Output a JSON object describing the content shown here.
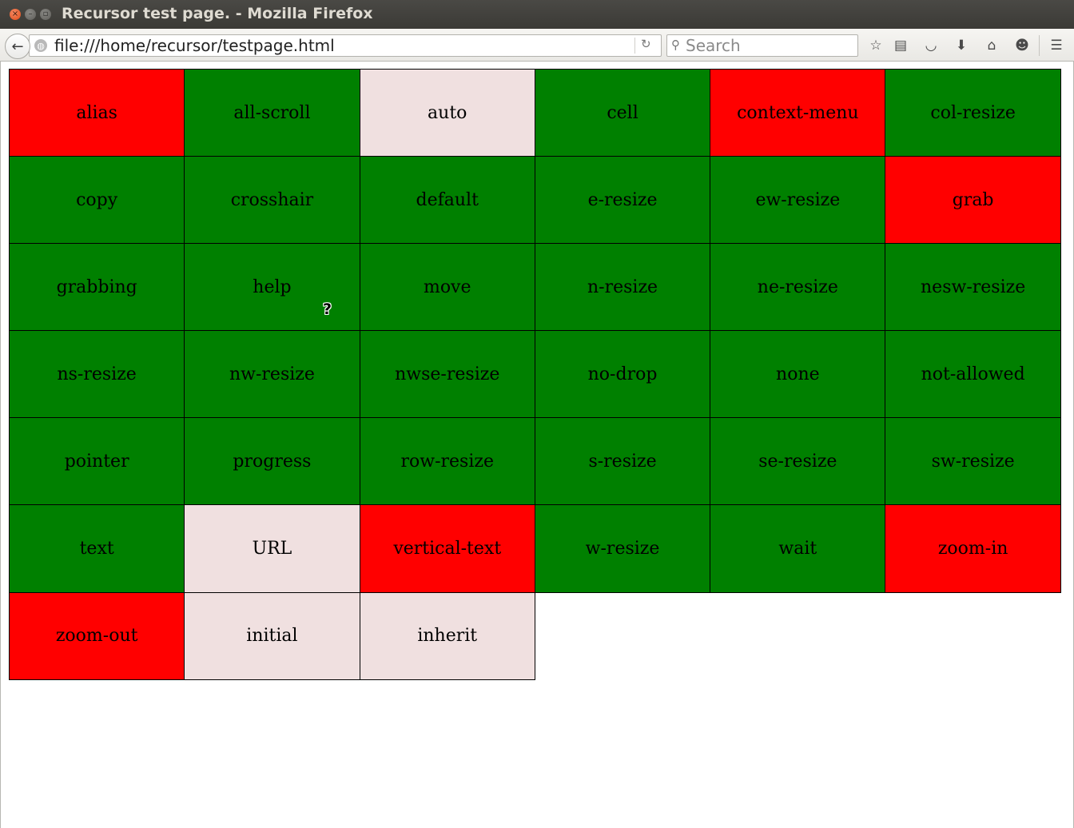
{
  "window": {
    "title": "Recursor test page. - Mozilla Firefox"
  },
  "toolbar": {
    "url": "file:///home/recursor/testpage.html",
    "search_placeholder": "Search"
  },
  "cells": [
    {
      "label": "alias",
      "status": "red"
    },
    {
      "label": "all-scroll",
      "status": "green"
    },
    {
      "label": "auto",
      "status": "light"
    },
    {
      "label": "cell",
      "status": "green"
    },
    {
      "label": "context-menu",
      "status": "red"
    },
    {
      "label": "col-resize",
      "status": "green"
    },
    {
      "label": "copy",
      "status": "green"
    },
    {
      "label": "crosshair",
      "status": "green"
    },
    {
      "label": "default",
      "status": "green"
    },
    {
      "label": "e-resize",
      "status": "green"
    },
    {
      "label": "ew-resize",
      "status": "green"
    },
    {
      "label": "grab",
      "status": "red"
    },
    {
      "label": "grabbing",
      "status": "green"
    },
    {
      "label": "help",
      "status": "green"
    },
    {
      "label": "move",
      "status": "green"
    },
    {
      "label": "n-resize",
      "status": "green"
    },
    {
      "label": "ne-resize",
      "status": "green"
    },
    {
      "label": "nesw-resize",
      "status": "green"
    },
    {
      "label": "ns-resize",
      "status": "green"
    },
    {
      "label": "nw-resize",
      "status": "green"
    },
    {
      "label": "nwse-resize",
      "status": "green"
    },
    {
      "label": "no-drop",
      "status": "green"
    },
    {
      "label": "none",
      "status": "green"
    },
    {
      "label": "not-allowed",
      "status": "green"
    },
    {
      "label": "pointer",
      "status": "green"
    },
    {
      "label": "progress",
      "status": "green"
    },
    {
      "label": "row-resize",
      "status": "green"
    },
    {
      "label": "s-resize",
      "status": "green"
    },
    {
      "label": "se-resize",
      "status": "green"
    },
    {
      "label": "sw-resize",
      "status": "green"
    },
    {
      "label": "text",
      "status": "green"
    },
    {
      "label": "URL",
      "status": "light"
    },
    {
      "label": "vertical-text",
      "status": "red"
    },
    {
      "label": "w-resize",
      "status": "green"
    },
    {
      "label": "wait",
      "status": "green"
    },
    {
      "label": "zoom-in",
      "status": "red"
    },
    {
      "label": "zoom-out",
      "status": "red"
    },
    {
      "label": "initial",
      "status": "light"
    },
    {
      "label": "inherit",
      "status": "light"
    }
  ],
  "colors": {
    "green": "#008000",
    "red": "#ff0000",
    "light": "#f0e0e0"
  }
}
